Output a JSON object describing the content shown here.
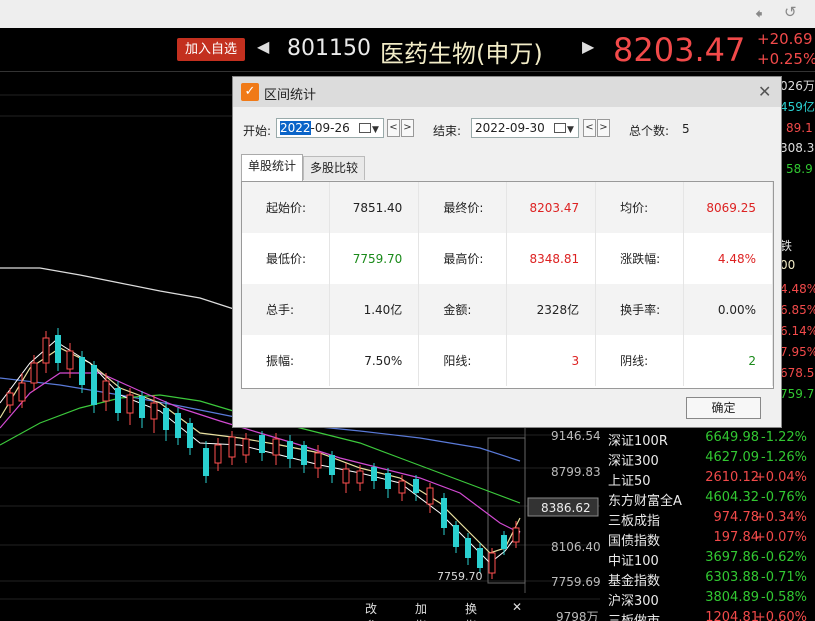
{
  "header": {
    "add_watch": "加入自选",
    "code": "801150",
    "name": "医药生物(申万)",
    "price": "8203.47",
    "change": "+20.69",
    "change_pct": "+0.25%"
  },
  "chart": {
    "y_ticks": [
      "9146.54",
      "8799.83",
      "8386.62",
      "8106.40",
      "7759.69",
      "9798万"
    ],
    "low_label": "7759.70",
    "bottom_tabs": [
      "改参数",
      "加指标",
      "换指标",
      "✕"
    ]
  },
  "right_cut": [
    "026万",
    "459亿",
    "89.1",
    "308.3",
    "58.9",
    "铁",
    "00",
    "4.48%",
    "6.85%",
    "6.14%",
    "7.95%",
    "678.5",
    "759.7"
  ],
  "index_list": [
    {
      "name": "深证100R",
      "value": "6649.98",
      "change": "-1.22%",
      "vcolor": "#32c832",
      "ccolor": "#32c832"
    },
    {
      "name": "深证300",
      "value": "4627.09",
      "change": "-1.26%",
      "vcolor": "#32c832",
      "ccolor": "#32c832"
    },
    {
      "name": "上证50",
      "value": "2610.12",
      "change": "+0.04%",
      "vcolor": "#f24a4a",
      "ccolor": "#f24a4a"
    },
    {
      "name": "东方财富全A",
      "value": "4604.32",
      "change": "-0.76%",
      "vcolor": "#32c832",
      "ccolor": "#32c832"
    },
    {
      "name": "三板成指",
      "value": "974.78",
      "change": "+0.34%",
      "vcolor": "#f24a4a",
      "ccolor": "#f24a4a"
    },
    {
      "name": "国债指数",
      "value": "197.84",
      "change": "+0.07%",
      "vcolor": "#f24a4a",
      "ccolor": "#f24a4a"
    },
    {
      "name": "中证100",
      "value": "3697.86",
      "change": "-0.62%",
      "vcolor": "#32c832",
      "ccolor": "#32c832"
    },
    {
      "name": "基金指数",
      "value": "6303.88",
      "change": "-0.71%",
      "vcolor": "#32c832",
      "ccolor": "#32c832"
    },
    {
      "name": "沪深300",
      "value": "3804.89",
      "change": "-0.58%",
      "vcolor": "#32c832",
      "ccolor": "#32c832"
    },
    {
      "name": "三板做市",
      "value": "1204.81",
      "change": "+0.60%",
      "vcolor": "#f24a4a",
      "ccolor": "#f24a4a"
    }
  ],
  "dialog": {
    "title": "区间统计",
    "start_label": "开始:",
    "start_year": "2022",
    "start_rest": "-09-26",
    "end_label": "结束:",
    "end_date": "2022-09-30",
    "count_label": "总个数:",
    "count_value": "5",
    "tabs": [
      "单股统计",
      "多股比较"
    ],
    "ok": "确定",
    "rows": [
      [
        {
          "k": "起始价:",
          "v": "7851.40",
          "c": "black"
        },
        {
          "k": "最终价:",
          "v": "8203.47",
          "c": "red"
        },
        {
          "k": "均价:",
          "v": "8069.25",
          "c": "red"
        }
      ],
      [
        {
          "k": "最低价:",
          "v": "7759.70",
          "c": "green"
        },
        {
          "k": "最高价:",
          "v": "8348.81",
          "c": "red"
        },
        {
          "k": "涨跌幅:",
          "v": "4.48%",
          "c": "red"
        }
      ],
      [
        {
          "k": "总手:",
          "v": "1.40亿",
          "c": "black"
        },
        {
          "k": "金额:",
          "v": "2328亿",
          "c": "black"
        },
        {
          "k": "换手率:",
          "v": "0.00%",
          "c": "black"
        }
      ],
      [
        {
          "k": "振幅:",
          "v": "7.50%",
          "c": "black"
        },
        {
          "k": "阳线:",
          "v": "3",
          "c": "red"
        },
        {
          "k": "阴线:",
          "v": "2",
          "c": "green"
        }
      ]
    ]
  }
}
